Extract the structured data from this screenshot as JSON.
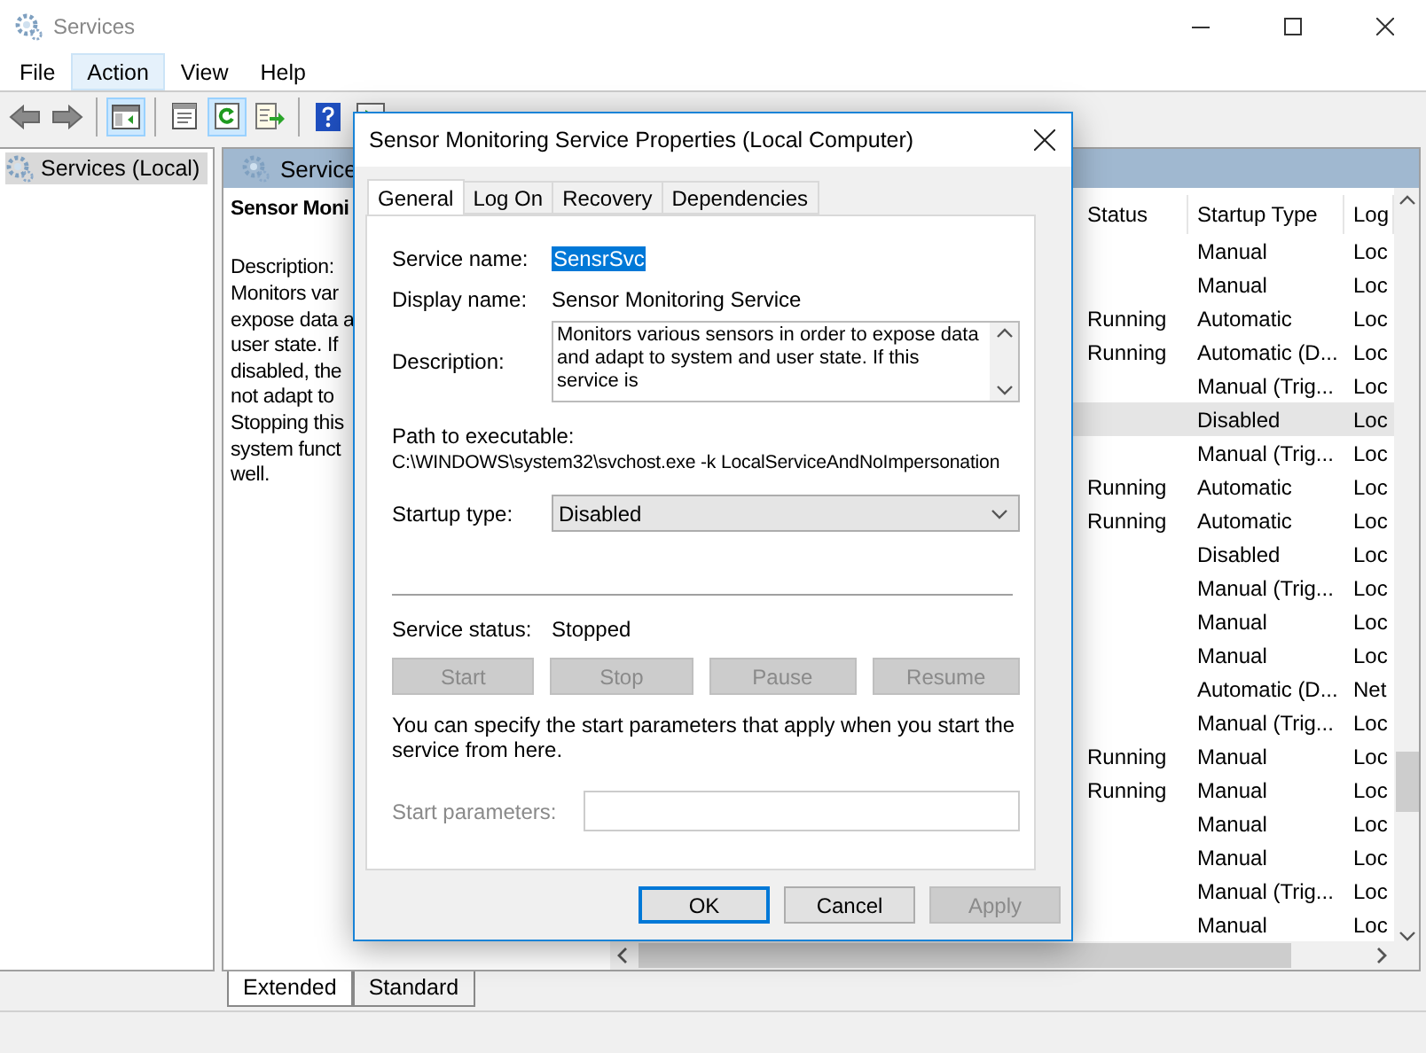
{
  "window": {
    "title": "Services"
  },
  "menu": [
    {
      "label": "File",
      "selected": false
    },
    {
      "label": "Action",
      "selected": true
    },
    {
      "label": "View",
      "selected": false
    },
    {
      "label": "Help",
      "selected": false
    }
  ],
  "toolbar": [
    {
      "kind": "back",
      "pressed": false
    },
    {
      "kind": "forward",
      "pressed": false
    },
    {
      "kind": "sep"
    },
    {
      "kind": "tree",
      "pressed": true
    },
    {
      "kind": "sep"
    },
    {
      "kind": "properties",
      "pressed": false
    },
    {
      "kind": "refresh",
      "pressed": true
    },
    {
      "kind": "export",
      "pressed": false
    },
    {
      "kind": "sep"
    },
    {
      "kind": "help",
      "pressed": false
    },
    {
      "kind": "play",
      "pressed": false
    }
  ],
  "tree": [
    {
      "label": "Services (Local)",
      "selected": true
    }
  ],
  "pane_header": {
    "title": "Service"
  },
  "details": {
    "title": "Sensor Moni",
    "lines": [
      "Description:",
      "Monitors var",
      "expose data a",
      "user state.  If",
      "disabled, the",
      "not adapt to",
      "Stopping this",
      "system funct",
      "well."
    ]
  },
  "table": {
    "columns": [
      "Status",
      "Startup Type",
      "Log"
    ],
    "rows": [
      {
        "startup": "Manual",
        "log": "Loc",
        "selected": false
      },
      {
        "startup": "Manual",
        "log": "Loc",
        "selected": false
      },
      {
        "status": "Running",
        "startup": "Automatic",
        "log": "Loc",
        "selected": false
      },
      {
        "status": "Running",
        "startup": "Automatic (D...",
        "log": "Loc",
        "selected": false
      },
      {
        "startup": "Manual (Trig...",
        "log": "Loc",
        "selected": false
      },
      {
        "startup": "Disabled",
        "log": "Loc",
        "selected": true
      },
      {
        "startup": "Manual (Trig...",
        "log": "Loc",
        "selected": false
      },
      {
        "status": "Running",
        "startup": "Automatic",
        "log": "Loc",
        "selected": false
      },
      {
        "status": "Running",
        "startup": "Automatic",
        "log": "Loc",
        "selected": false
      },
      {
        "startup": "Disabled",
        "log": "Loc",
        "selected": false
      },
      {
        "startup": "Manual (Trig...",
        "log": "Loc",
        "selected": false
      },
      {
        "startup": "Manual",
        "log": "Loc",
        "selected": false
      },
      {
        "startup": "Manual",
        "log": "Loc",
        "selected": false
      },
      {
        "startup": "Automatic (D...",
        "log": "Net",
        "selected": false
      },
      {
        "startup": "Manual (Trig...",
        "log": "Loc",
        "selected": false
      },
      {
        "status": "Running",
        "startup": "Manual",
        "log": "Loc",
        "selected": false
      },
      {
        "status": "Running",
        "startup": "Manual",
        "log": "Loc",
        "selected": false
      },
      {
        "startup": "Manual",
        "log": "Loc",
        "selected": false
      },
      {
        "startup": "Manual",
        "log": "Loc",
        "selected": false
      },
      {
        "startup": "Manual (Trig...",
        "log": "Loc",
        "selected": false
      },
      {
        "startup": "Manual",
        "log": "Loc",
        "selected": false
      }
    ]
  },
  "view_tabs": [
    {
      "label": "Extended",
      "selected": true
    },
    {
      "label": "Standard",
      "selected": false
    }
  ],
  "dialog": {
    "title": "Sensor Monitoring Service Properties (Local Computer)",
    "tabs": [
      {
        "label": "General",
        "selected": true
      },
      {
        "label": "Log On",
        "selected": false
      },
      {
        "label": "Recovery",
        "selected": false
      },
      {
        "label": "Dependencies",
        "selected": false
      }
    ],
    "service_name": {
      "label": "Service name:",
      "value": "SensrSvc"
    },
    "display_name": {
      "label": "Display name:",
      "value": "Sensor Monitoring Service"
    },
    "description": {
      "label": "Description:",
      "value": "Monitors various sensors in order to expose data and adapt to system and user state.  If this service is"
    },
    "path": {
      "label": "Path to executable:",
      "value": "C:\\WINDOWS\\system32\\svchost.exe -k LocalServiceAndNoImpersonation"
    },
    "startup_type": {
      "label": "Startup type:",
      "value": "Disabled"
    },
    "service_status": {
      "label": "Service status:",
      "value": "Stopped"
    },
    "control_buttons": [
      {
        "label": "Start",
        "disabled": true
      },
      {
        "label": "Stop",
        "disabled": true
      },
      {
        "label": "Pause",
        "disabled": true
      },
      {
        "label": "Resume",
        "disabled": true
      }
    ],
    "hint": "You can specify the start parameters that apply when you start the service from here.",
    "start_parameters": {
      "label": "Start parameters:",
      "disabled": true
    },
    "buttons": [
      {
        "label": "OK",
        "default": true,
        "disabled": false
      },
      {
        "label": "Cancel",
        "default": false,
        "disabled": false
      },
      {
        "label": "Apply",
        "default": false,
        "disabled": true
      }
    ]
  }
}
